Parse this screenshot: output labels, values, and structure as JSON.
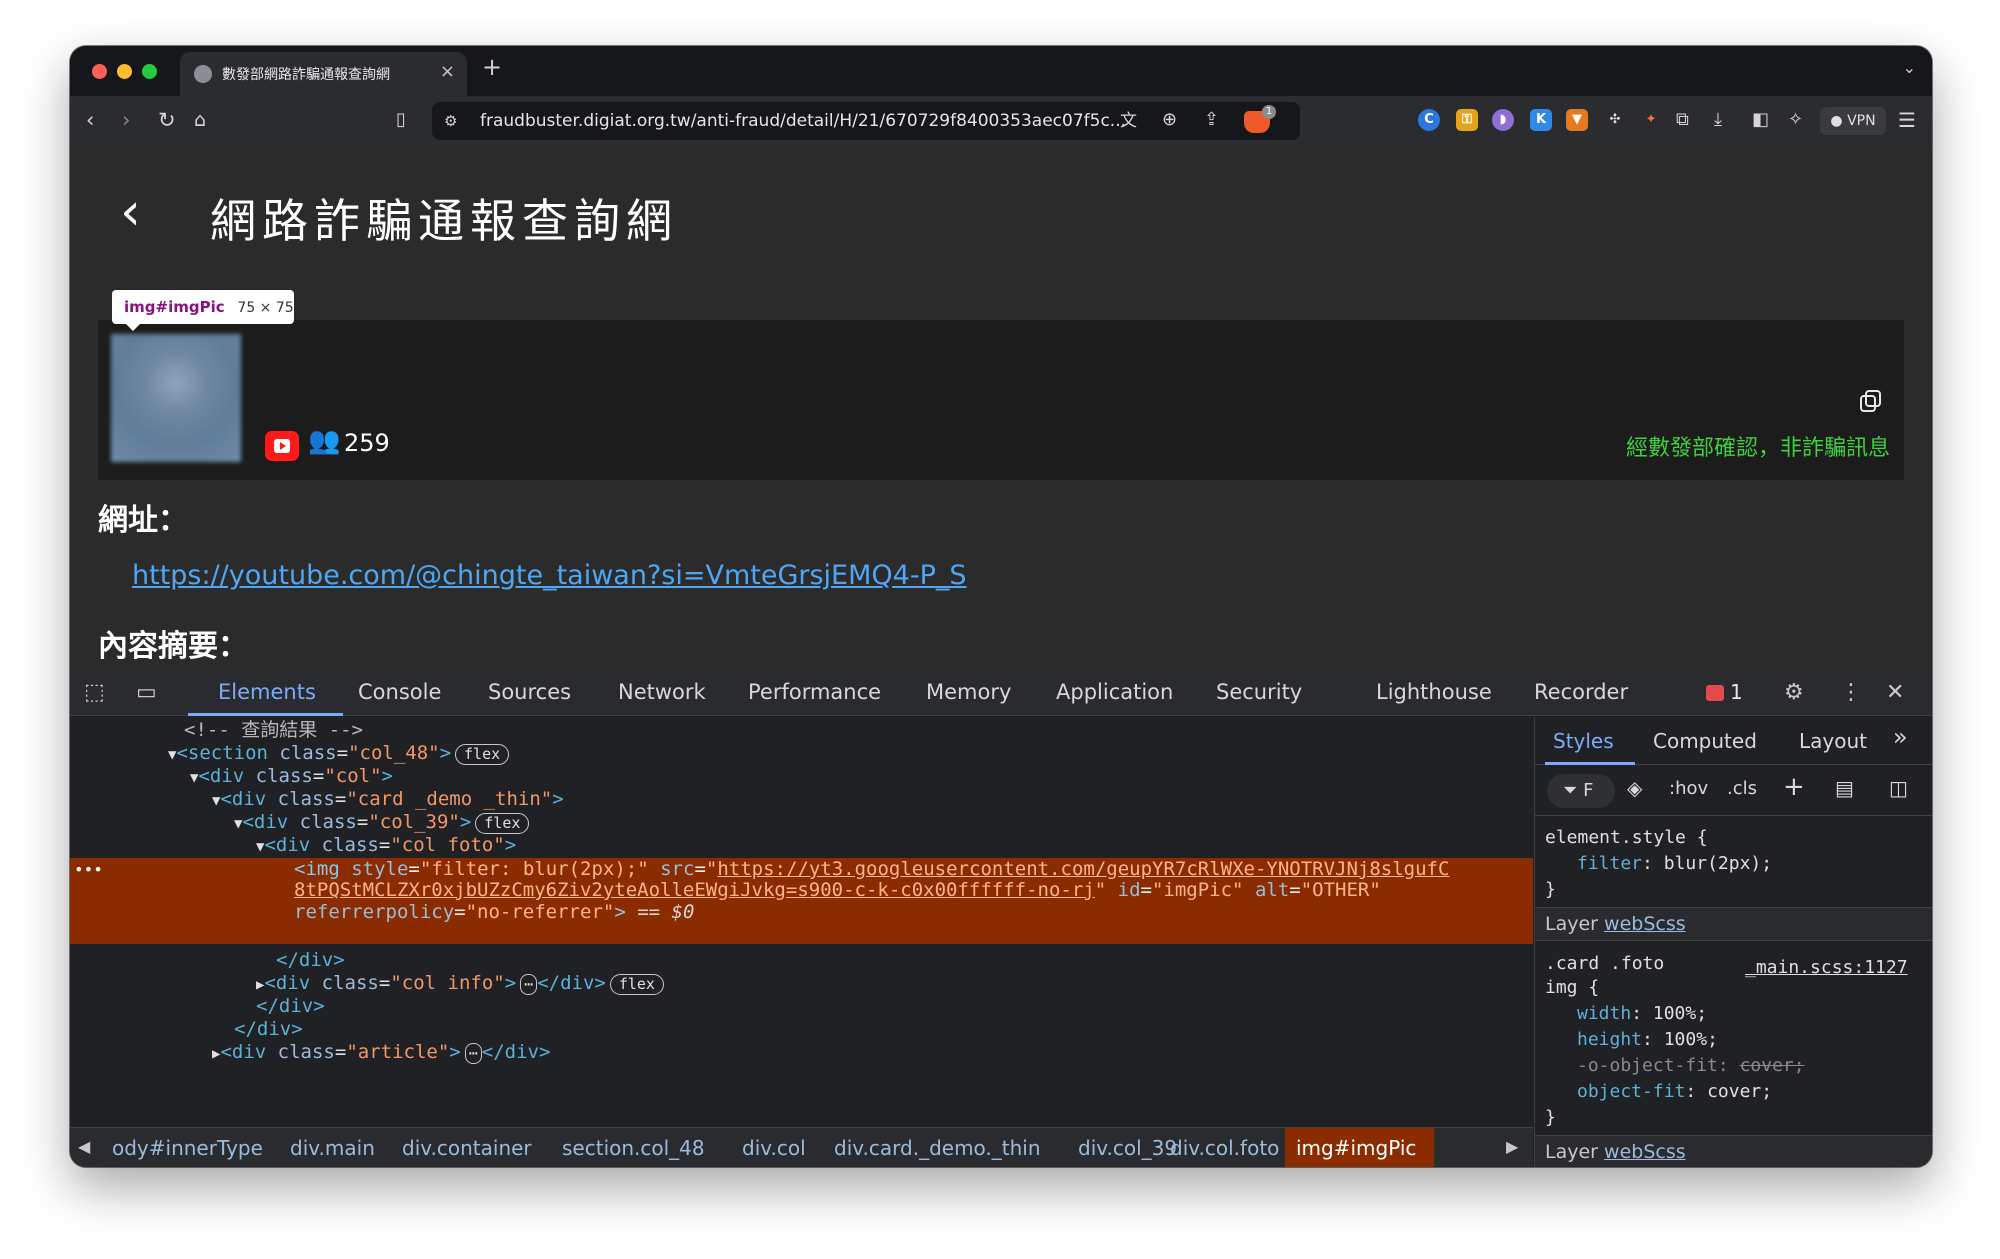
{
  "browser": {
    "tab_title": "數發部網路詐騙通報查詢網",
    "tab_close": "×",
    "new_tab": "+",
    "url": "fraudbuster.digiat.org.tw/anti-fraud/detail/H/21/670729f8400353aec07f5c...",
    "shield_badge": "1",
    "vpn_label": "VPN",
    "icons": [
      "back-icon",
      "forward-icon",
      "reload-icon",
      "home-icon",
      "bookmark-icon",
      "site-info-icon",
      "translate-icon",
      "zoom-icon",
      "share-icon",
      "brave-shield-icon",
      "extensions-icon",
      "download-icon",
      "sidebar-icon",
      "leo-icon",
      "menu-icon"
    ]
  },
  "page": {
    "back_glyph": "‹",
    "title": "網路詐騙通報查詢網",
    "tooltip": {
      "tag": "img#imgPic",
      "size": "75 × 75"
    },
    "subscriber_count": "259",
    "verified_text": "經數發部確認，非詐騙訊息",
    "address_heading": "網址：",
    "link": "https://youtube.com/@chingte_taiwan?si=VmteGrsjEMQ4-P_S",
    "summary_heading": "內容摘要："
  },
  "devtools": {
    "tabs": [
      "Elements",
      "Console",
      "Sources",
      "Network",
      "Performance",
      "Memory",
      "Application",
      "Security",
      "Lighthouse",
      "Recorder"
    ],
    "active_tab": "Elements",
    "error_count": "1",
    "dom": {
      "comment": "<!-- 查詢結果 -->",
      "section_open": "<section",
      "section_class_attr": "class=",
      "section_class": "\"col_48\"",
      "flex_badge": "flex",
      "div_col": "\"col\"",
      "div_card": "\"card _demo _thin\"",
      "div_col39": "\"col_39\"",
      "div_foto": "\"col foto\"",
      "img_style": "\"filter: blur(2px);\"",
      "img_src_1": "https://yt3.googleusercontent.com/geupYR7cRlWXe-YNOTRVJNj8slgufC",
      "img_src_2": "8tPQStMCLZXr0xjbUZzCmy6Ziv2yteAolleEWgiJvkg=s900-c-k-c0x00ffffff-no-rj",
      "img_id": "\"imgPic\"",
      "img_alt": "\"OTHER\"",
      "img_referrer": "\"no-referrer\"",
      "dollar0": "== $0",
      "close_div": "</div>",
      "div_info": "\"col info\"",
      "div_article": "\"article\"",
      "ellipsis": "⋯"
    },
    "breadcrumbs": [
      "ody#innerType",
      "div.main",
      "div.container",
      "section.col_48",
      "div.col",
      "div.card._demo._thin",
      "div.col_39",
      "div.col.foto",
      "img#imgPic"
    ],
    "styles": {
      "tabs": [
        "Styles",
        "Computed",
        "Layout"
      ],
      "more": "»",
      "filter_label": "F",
      "hov": ":hov",
      "cls": ".cls",
      "element_style": "element.style {",
      "rule1_prop": "filter",
      "rule1_val": "blur(2px);",
      "layer_label": "Layer",
      "layer_name": "webScss",
      "selector": ".card .foto",
      "selector2": "img {",
      "source": "_main.scss:1127",
      "props": [
        {
          "name": "width",
          "value": "100%;"
        },
        {
          "name": "height",
          "value": "100%;"
        },
        {
          "name": "-o-object-fit",
          "value": "cover;"
        },
        {
          "name": "object-fit",
          "value": "cover;"
        }
      ],
      "close_brace": "}"
    }
  },
  "colors": {
    "accent": "#7cacf8",
    "selection": "#8a2b00",
    "verified": "#3fcf3f",
    "link": "#4ea6f5"
  }
}
